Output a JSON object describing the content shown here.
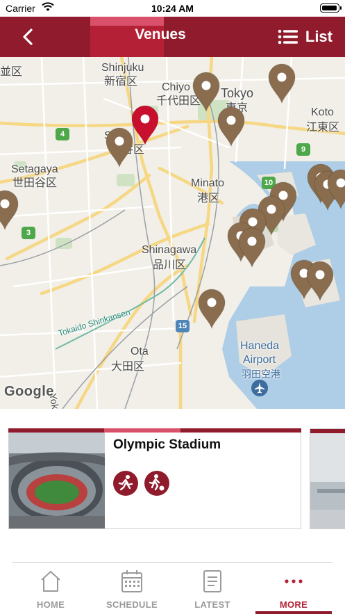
{
  "status_bar": {
    "carrier": "Carrier",
    "time": "10:24 AM",
    "battery_level": 1.0
  },
  "nav": {
    "title": "Venues",
    "list_label": "List",
    "back_icon": "chevron-left-icon",
    "list_icon": "list-icon"
  },
  "map": {
    "labels": {
      "shinjuku_en": "Shinjuku",
      "shinjuku_jp": "新宿区",
      "chiyoda_en": "Chiyo",
      "chiyoda_jp": "千代田区",
      "tokyo_en": "Tokyo",
      "tokyo_jp": "東京",
      "koto_en": "Koto",
      "koto_jp": "江東区",
      "shibuya_en": "Sh",
      "shibuya_jp": "谷区",
      "setagaya_en": "Setagaya",
      "setagaya_jp": "世田谷区",
      "minato_en": "Minato",
      "minato_jp": "港区",
      "shinagawa_en": "Shinagawa",
      "shinagawa_jp": "品川区",
      "ota_en": "Ota",
      "ota_jp": "大田区",
      "haneda_en": "Haneda",
      "haneda_en2": "Airport",
      "haneda_jp": "羽田空港",
      "nami_jp": "並区",
      "rail": "Tokaido Shinkansen",
      "yokos": "Yokos"
    },
    "route_badges": [
      "4",
      "9",
      "10",
      "3",
      "15"
    ],
    "attribution": "Google",
    "selected_pin_color": "#c8102e",
    "pin_color": "#8a6d4e"
  },
  "venue": {
    "name": "Olympic Stadium",
    "sports": [
      "athletics-icon",
      "football-icon"
    ]
  },
  "tabs": [
    {
      "label": "HOME",
      "icon": "home-icon",
      "active": false
    },
    {
      "label": "SCHEDULE",
      "icon": "calendar-icon",
      "active": false
    },
    {
      "label": "LATEST",
      "icon": "news-icon",
      "active": false
    },
    {
      "label": "MORE",
      "icon": "more-icon",
      "active": true
    }
  ],
  "colors": {
    "brand": "#8f1b2c",
    "brand_light": "#b42136",
    "accent": "#d9506a"
  }
}
